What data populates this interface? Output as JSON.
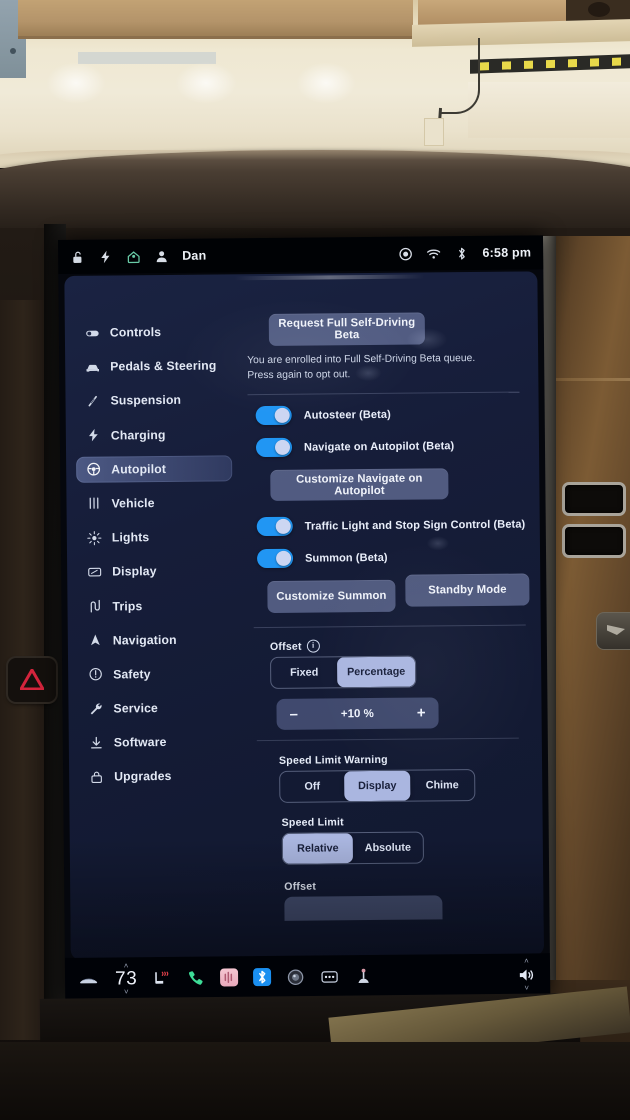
{
  "status_bar": {
    "icons_left": [
      "lock-icon",
      "bolt-icon",
      "home-icon",
      "person-icon"
    ],
    "driver_profile": "Dan",
    "icons_right": [
      "record-icon",
      "wifi-icon",
      "bluetooth-icon"
    ],
    "time": "6:58 pm"
  },
  "sidebar": {
    "items": [
      {
        "label": "Controls",
        "icon": "toggle-icon",
        "active": false
      },
      {
        "label": "Pedals & Steering",
        "icon": "car-icon",
        "active": false
      },
      {
        "label": "Suspension",
        "icon": "shock-absorber-icon",
        "active": false
      },
      {
        "label": "Charging",
        "icon": "bolt-icon",
        "active": false
      },
      {
        "label": "Autopilot",
        "icon": "steering-wheel-icon",
        "active": true
      },
      {
        "label": "Vehicle",
        "icon": "sliders-icon",
        "active": false
      },
      {
        "label": "Lights",
        "icon": "sun-icon",
        "active": false
      },
      {
        "label": "Display",
        "icon": "screen-icon",
        "active": false
      },
      {
        "label": "Trips",
        "icon": "winding-road-icon",
        "active": false
      },
      {
        "label": "Navigation",
        "icon": "nav-arrow-icon",
        "active": false
      },
      {
        "label": "Safety",
        "icon": "alert-circle-icon",
        "active": false
      },
      {
        "label": "Service",
        "icon": "wrench-icon",
        "active": false
      },
      {
        "label": "Software",
        "icon": "download-icon",
        "active": false
      },
      {
        "label": "Upgrades",
        "icon": "lock-bag-icon",
        "active": false
      }
    ]
  },
  "autopilot": {
    "request_fsd_button": "Request Full Self-Driving Beta",
    "enrollment_note": "You are enrolled into Full Self-Driving Beta queue. Press again to opt out.",
    "toggles": [
      {
        "label": "Autosteer (Beta)",
        "on": true
      },
      {
        "label": "Navigate on Autopilot (Beta)",
        "on": true
      },
      {
        "label": "Traffic Light and Stop Sign Control (Beta)",
        "on": true
      },
      {
        "label": "Summon (Beta)",
        "on": true
      }
    ],
    "customize_nav_button": "Customize Navigate on Autopilot",
    "customize_summon_button": "Customize Summon",
    "standby_mode_button": "Standby Mode",
    "offset_section": {
      "label": "Offset",
      "info_icon": "info-icon",
      "options": [
        "Fixed",
        "Percentage"
      ],
      "selected": "Percentage",
      "stepper": {
        "minus": "–",
        "value": "+10 %",
        "plus": "+"
      }
    },
    "speed_limit_warning": {
      "label": "Speed Limit Warning",
      "options": [
        "Off",
        "Display",
        "Chime"
      ],
      "selected": "Display"
    },
    "speed_limit": {
      "label": "Speed Limit",
      "options": [
        "Relative",
        "Absolute"
      ],
      "selected": "Relative"
    },
    "offset_section_2": {
      "label": "Offset"
    }
  },
  "app_bar": {
    "car_icon": "car-icon",
    "temperature": "73",
    "temp_up": "˄",
    "temp_down": "˅",
    "items": [
      {
        "icon": "seat-heater-icon"
      },
      {
        "icon": "phone-icon"
      },
      {
        "icon": "media-icon"
      },
      {
        "icon": "bluetooth-icon"
      },
      {
        "icon": "camera-icon"
      },
      {
        "icon": "dots-menu-icon"
      },
      {
        "icon": "joystick-icon"
      }
    ],
    "volume_icon": "volume-icon",
    "vol_up": "˄",
    "vol_down": "˅"
  },
  "colors": {
    "screen_bg": "#141c38",
    "accent_blue": "#2196f3",
    "button_lavender": "#8995c4",
    "selected_segment": "#aab6e0",
    "text_primary": "#e9eefa",
    "home_icon_green": "#6fd6b0",
    "phone_green": "#3ddc97",
    "media_pink": "#f0b8c8",
    "bluetooth_blue": "#1a8ff0"
  }
}
